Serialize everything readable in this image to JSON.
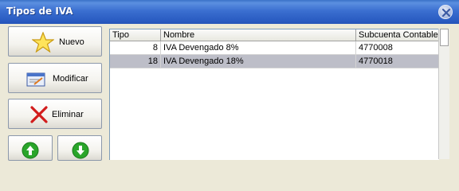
{
  "window": {
    "title": "Tipos de IVA"
  },
  "buttons": {
    "nuevo": "Nuevo",
    "modificar": "Modificar",
    "eliminar": "Eliminar"
  },
  "icons": {
    "nuevo": "star-icon",
    "modificar": "edit-form-icon",
    "eliminar": "red-x-icon",
    "up": "arrow-up-icon",
    "down": "arrow-down-icon"
  },
  "table": {
    "columns": [
      "Tipo",
      "Nombre",
      "Subcuenta Contable"
    ],
    "rows": [
      {
        "tipo": "8",
        "nombre": "IVA Devengado 8%",
        "subcuenta": "4770008"
      },
      {
        "tipo": "18",
        "nombre": "IVA Devengado 18%",
        "subcuenta": "4770018"
      }
    ]
  }
}
